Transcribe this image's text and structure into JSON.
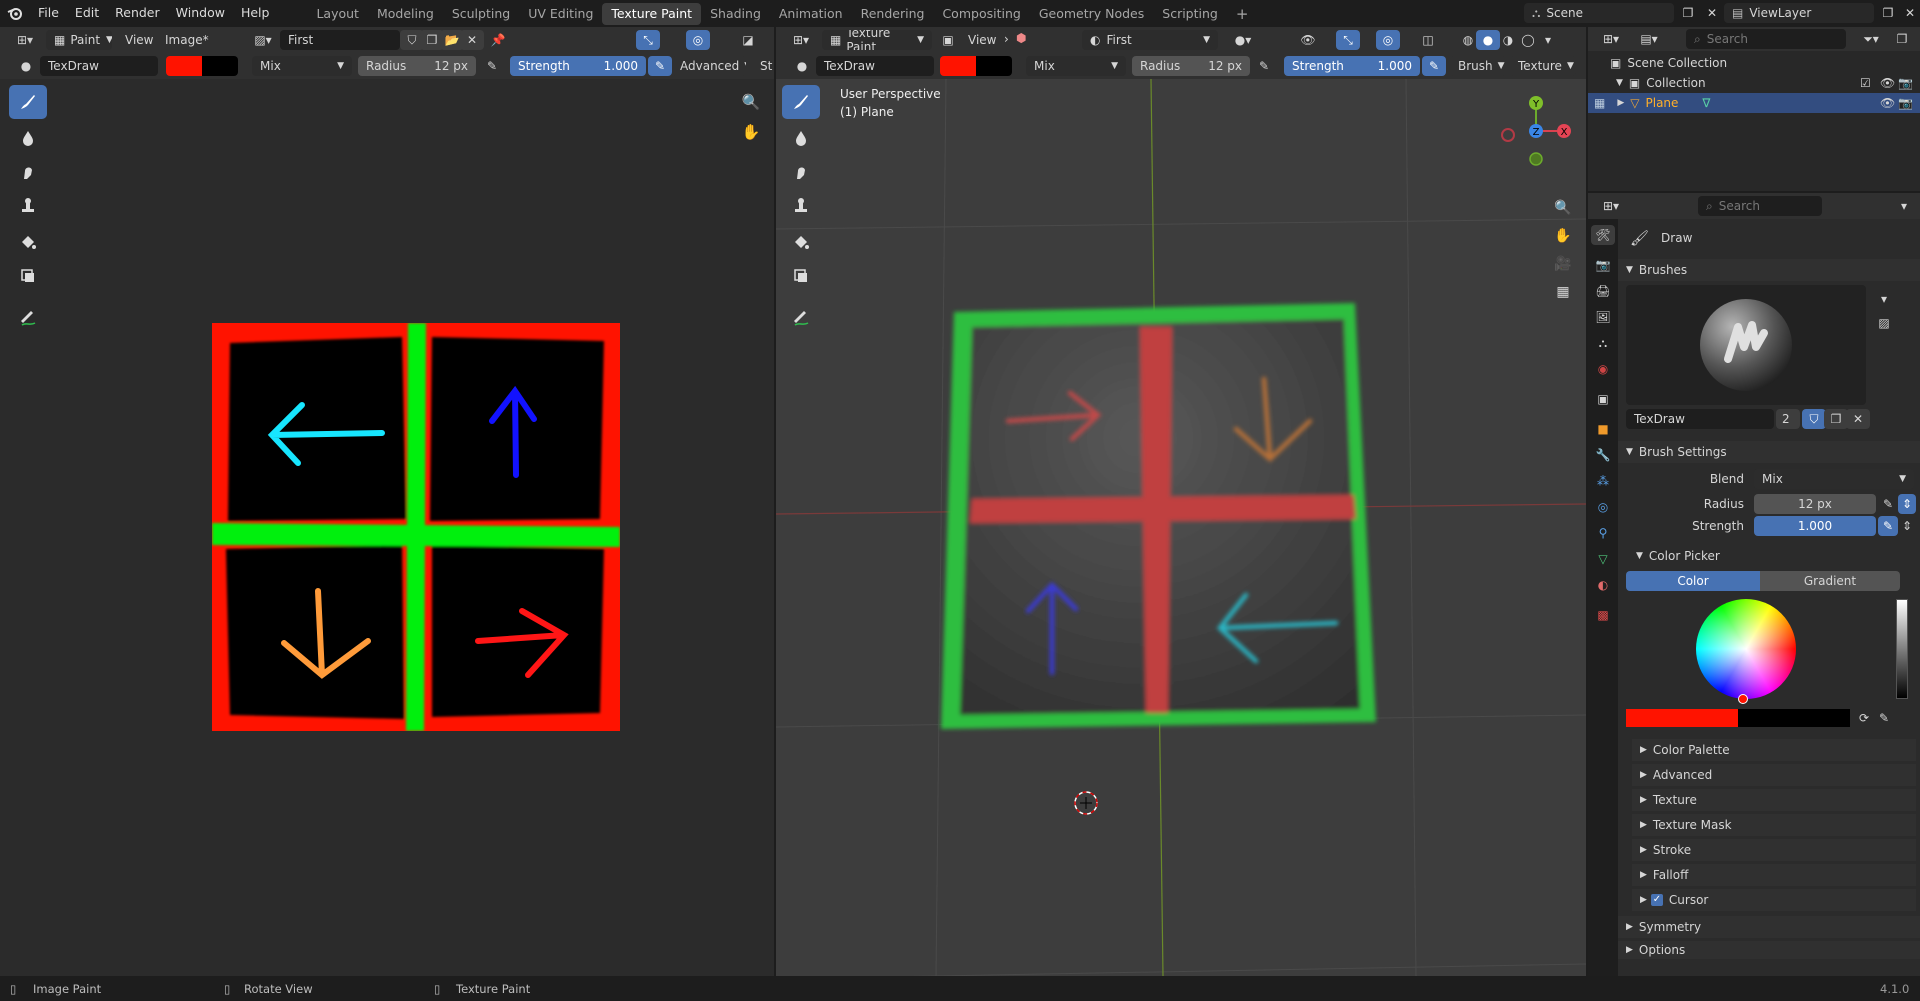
{
  "app": {
    "version": "4.1.0"
  },
  "menu": [
    "File",
    "Edit",
    "Render",
    "Window",
    "Help"
  ],
  "workspaces": [
    {
      "label": "Layout",
      "active": false
    },
    {
      "label": "Modeling",
      "active": false
    },
    {
      "label": "Sculpting",
      "active": false
    },
    {
      "label": "UV Editing",
      "active": false
    },
    {
      "label": "Texture Paint",
      "active": true
    },
    {
      "label": "Shading",
      "active": false
    },
    {
      "label": "Animation",
      "active": false
    },
    {
      "label": "Rendering",
      "active": false
    },
    {
      "label": "Compositing",
      "active": false
    },
    {
      "label": "Geometry Nodes",
      "active": false
    },
    {
      "label": "Scripting",
      "active": false
    }
  ],
  "scene": {
    "name": "Scene"
  },
  "view_layer": {
    "name": "ViewLayer"
  },
  "image_editor": {
    "mode": "Paint",
    "view_menu": "View",
    "image_menu": "Image*",
    "image_name": "First",
    "brush_name": "TexDraw",
    "blend": "Mix",
    "radius_label": "Radius",
    "radius_value": "12 px",
    "strength_label": "Strength",
    "strength_value": "1.000",
    "advanced_label": "Advanced",
    "cut_label": "St"
  },
  "viewport": {
    "mode": "Texture Paint",
    "view_menu": "View",
    "uv_name": "First",
    "brush_name": "TexDraw",
    "blend": "Mix",
    "radius_label": "Radius",
    "radius_value": "12 px",
    "strength_label": "Strength",
    "strength_value": "1.000",
    "brush_menu": "Brush",
    "texture_menu": "Texture",
    "perspective": "User Perspective",
    "object": "(1) Plane",
    "gizmo": {
      "x": "X",
      "y": "Y",
      "z": "Z"
    }
  },
  "outliner": {
    "search_placeholder": "Search",
    "scene_collection": "Scene Collection",
    "collection": "Collection",
    "plane": "Plane"
  },
  "properties": {
    "search_placeholder": "Search",
    "tool_name": "Draw",
    "brushes_label": "Brushes",
    "brush_name": "TexDraw",
    "brush_users": "2",
    "brush_settings_label": "Brush Settings",
    "blend_label": "Blend",
    "blend_value": "Mix",
    "radius_label": "Radius",
    "radius_value": "12 px",
    "strength_label": "Strength",
    "strength_value": "1.000",
    "color_picker_label": "Color Picker",
    "color_tab": "Color",
    "gradient_tab": "Gradient",
    "sections": [
      "Color Palette",
      "Advanced",
      "Texture",
      "Texture Mask",
      "Stroke",
      "Falloff",
      "Cursor"
    ],
    "symmetry": "Symmetry",
    "options": "Options"
  },
  "status": {
    "left": "Image Paint",
    "mid": "Rotate View",
    "right": "Texture Paint"
  },
  "colors": {
    "accent": "#4772b3",
    "primary_color": "#ff1300",
    "secondary_color": "#000000"
  }
}
